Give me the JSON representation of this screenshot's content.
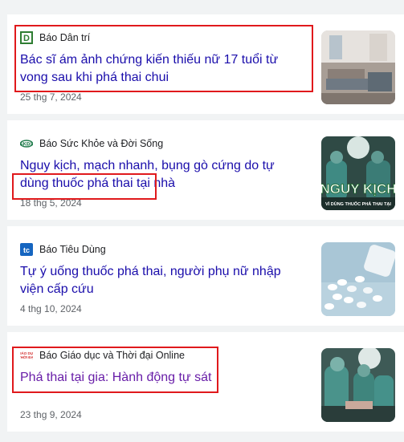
{
  "articles": [
    {
      "source": "Báo Dân trí",
      "logo_icon": "dan-tri-logo-icon",
      "headline": "Bác sĩ ám ảnh chứng kiến thiếu nữ 17 tuổi từ vong sau khi phá thai chui",
      "date": "25 thg 7, 2024",
      "thumbnail": "hospital-ward-image"
    },
    {
      "source": "Báo Sức Khỏe và Đời Sống",
      "logo_icon": "suc-khoe-doi-song-logo-icon",
      "headline": "Nguy kịch, mạch nhanh, bụng gò cứng do tự dùng thuốc phá thai tại nhà",
      "date": "18 thg 5, 2024",
      "thumbnail": "surgeons-operating-image",
      "thumb_title": "NGUY KỊCH",
      "thumb_subtitle": "VÌ DÙNG THUỐC PHÁ THAI TẠI"
    },
    {
      "source": "Báo Tiêu Dùng",
      "logo_icon": "tieu-dung-logo-icon",
      "headline": "Tự ý uống thuốc phá thai, người phụ nữ nhập viện cấp cứu",
      "date": "4 thg 10, 2024",
      "thumbnail": "pills-bottle-image"
    },
    {
      "source": "Báo Giáo dục và Thời đại Online",
      "logo_icon": "giao-duc-thoi-dai-logo-icon",
      "headline": "Phá thai tại gia: Hành động tự sát",
      "date": "23 thg 9, 2024",
      "thumbnail": "operating-room-image"
    }
  ],
  "colors": {
    "link": "#1a0dab",
    "visited_link": "#681da8",
    "highlight_box": "#e0191c",
    "background": "#f1f3f4"
  }
}
